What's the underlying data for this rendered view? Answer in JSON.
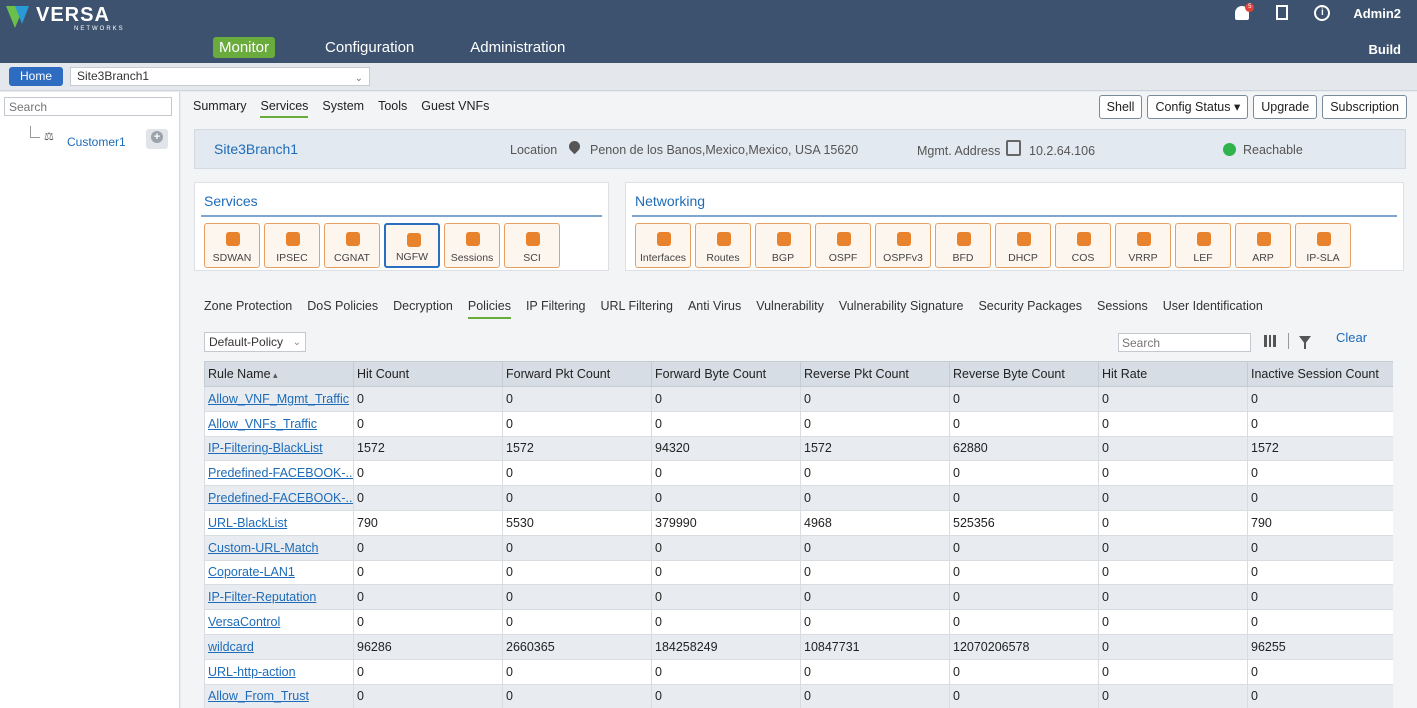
{
  "brand": {
    "name": "VERSA",
    "sub": "NETWORKS"
  },
  "nav": {
    "items": [
      "Monitor",
      "Configuration",
      "Administration"
    ],
    "active": "Monitor"
  },
  "header": {
    "bell_count": "5",
    "user": "Admin2",
    "build": "Build"
  },
  "breadcrumb": {
    "home": "Home",
    "site": "Site3Branch1"
  },
  "left": {
    "search_placeholder": "Search",
    "tree_item": "Customer1"
  },
  "subtabs": [
    "Summary",
    "Services",
    "System",
    "Tools",
    "Guest VNFs"
  ],
  "subtab_active": 1,
  "actions": {
    "shell": "Shell",
    "config_status": "Config Status ▾",
    "upgrade": "Upgrade",
    "subscription": "Subscription"
  },
  "site": {
    "name": "Site3Branch1",
    "location_label": "Location",
    "location": "Penon de los Banos,Mexico,Mexico, USA 15620",
    "mgmt_label": "Mgmt. Address",
    "mgmt_address": "10.2.64.106",
    "status": "Reachable",
    "status_color": "#2fb34a"
  },
  "services": {
    "title": "Services",
    "tiles": [
      "SDWAN",
      "IPSEC",
      "CGNAT",
      "NGFW",
      "Sessions",
      "SCI"
    ],
    "selected": "NGFW"
  },
  "networking": {
    "title": "Networking",
    "tiles": [
      "Interfaces",
      "Routes",
      "BGP",
      "OSPF",
      "OSPFv3",
      "BFD",
      "DHCP",
      "COS",
      "VRRP",
      "LEF",
      "ARP",
      "IP-SLA"
    ]
  },
  "ptabs": [
    "Zone Protection",
    "DoS Policies",
    "Decryption",
    "Policies",
    "IP Filtering",
    "URL Filtering",
    "Anti Virus",
    "Vulnerability",
    "Vulnerability Signature",
    "Security Packages",
    "Sessions",
    "User Identification"
  ],
  "ptab_active": 3,
  "policy": {
    "selected": "Default-Policy"
  },
  "table_tools": {
    "search_placeholder": "Search",
    "clear": "Clear"
  },
  "table": {
    "columns": [
      "Rule Name",
      "Hit Count",
      "Forward Pkt Count",
      "Forward Byte Count",
      "Reverse Pkt Count",
      "Reverse Byte Count",
      "Hit Rate",
      "Inactive Session Count"
    ],
    "rows": [
      [
        "Allow_VNF_Mgmt_Traffic",
        "0",
        "0",
        "0",
        "0",
        "0",
        "0",
        "0"
      ],
      [
        "Allow_VNFs_Traffic",
        "0",
        "0",
        "0",
        "0",
        "0",
        "0",
        "0"
      ],
      [
        "IP-Filtering-BlackList",
        "1572",
        "1572",
        "94320",
        "1572",
        "62880",
        "0",
        "1572"
      ],
      [
        "Predefined-FACEBOOK-...",
        "0",
        "0",
        "0",
        "0",
        "0",
        "0",
        "0"
      ],
      [
        "Predefined-FACEBOOK-...",
        "0",
        "0",
        "0",
        "0",
        "0",
        "0",
        "0"
      ],
      [
        "URL-BlackList",
        "790",
        "5530",
        "379990",
        "4968",
        "525356",
        "0",
        "790"
      ],
      [
        "Custom-URL-Match",
        "0",
        "0",
        "0",
        "0",
        "0",
        "0",
        "0"
      ],
      [
        "Coporate-LAN1",
        "0",
        "0",
        "0",
        "0",
        "0",
        "0",
        "0"
      ],
      [
        "IP-Filter-Reputation",
        "0",
        "0",
        "0",
        "0",
        "0",
        "0",
        "0"
      ],
      [
        "VersaControl",
        "0",
        "0",
        "0",
        "0",
        "0",
        "0",
        "0"
      ],
      [
        "wildcard",
        "96286",
        "2660365",
        "184258249",
        "10847731",
        "12070206578",
        "0",
        "96255"
      ],
      [
        "URL-http-action",
        "0",
        "0",
        "0",
        "0",
        "0",
        "0",
        "0"
      ],
      [
        "Allow_From_Trust",
        "0",
        "0",
        "0",
        "0",
        "0",
        "0",
        "0"
      ]
    ]
  }
}
